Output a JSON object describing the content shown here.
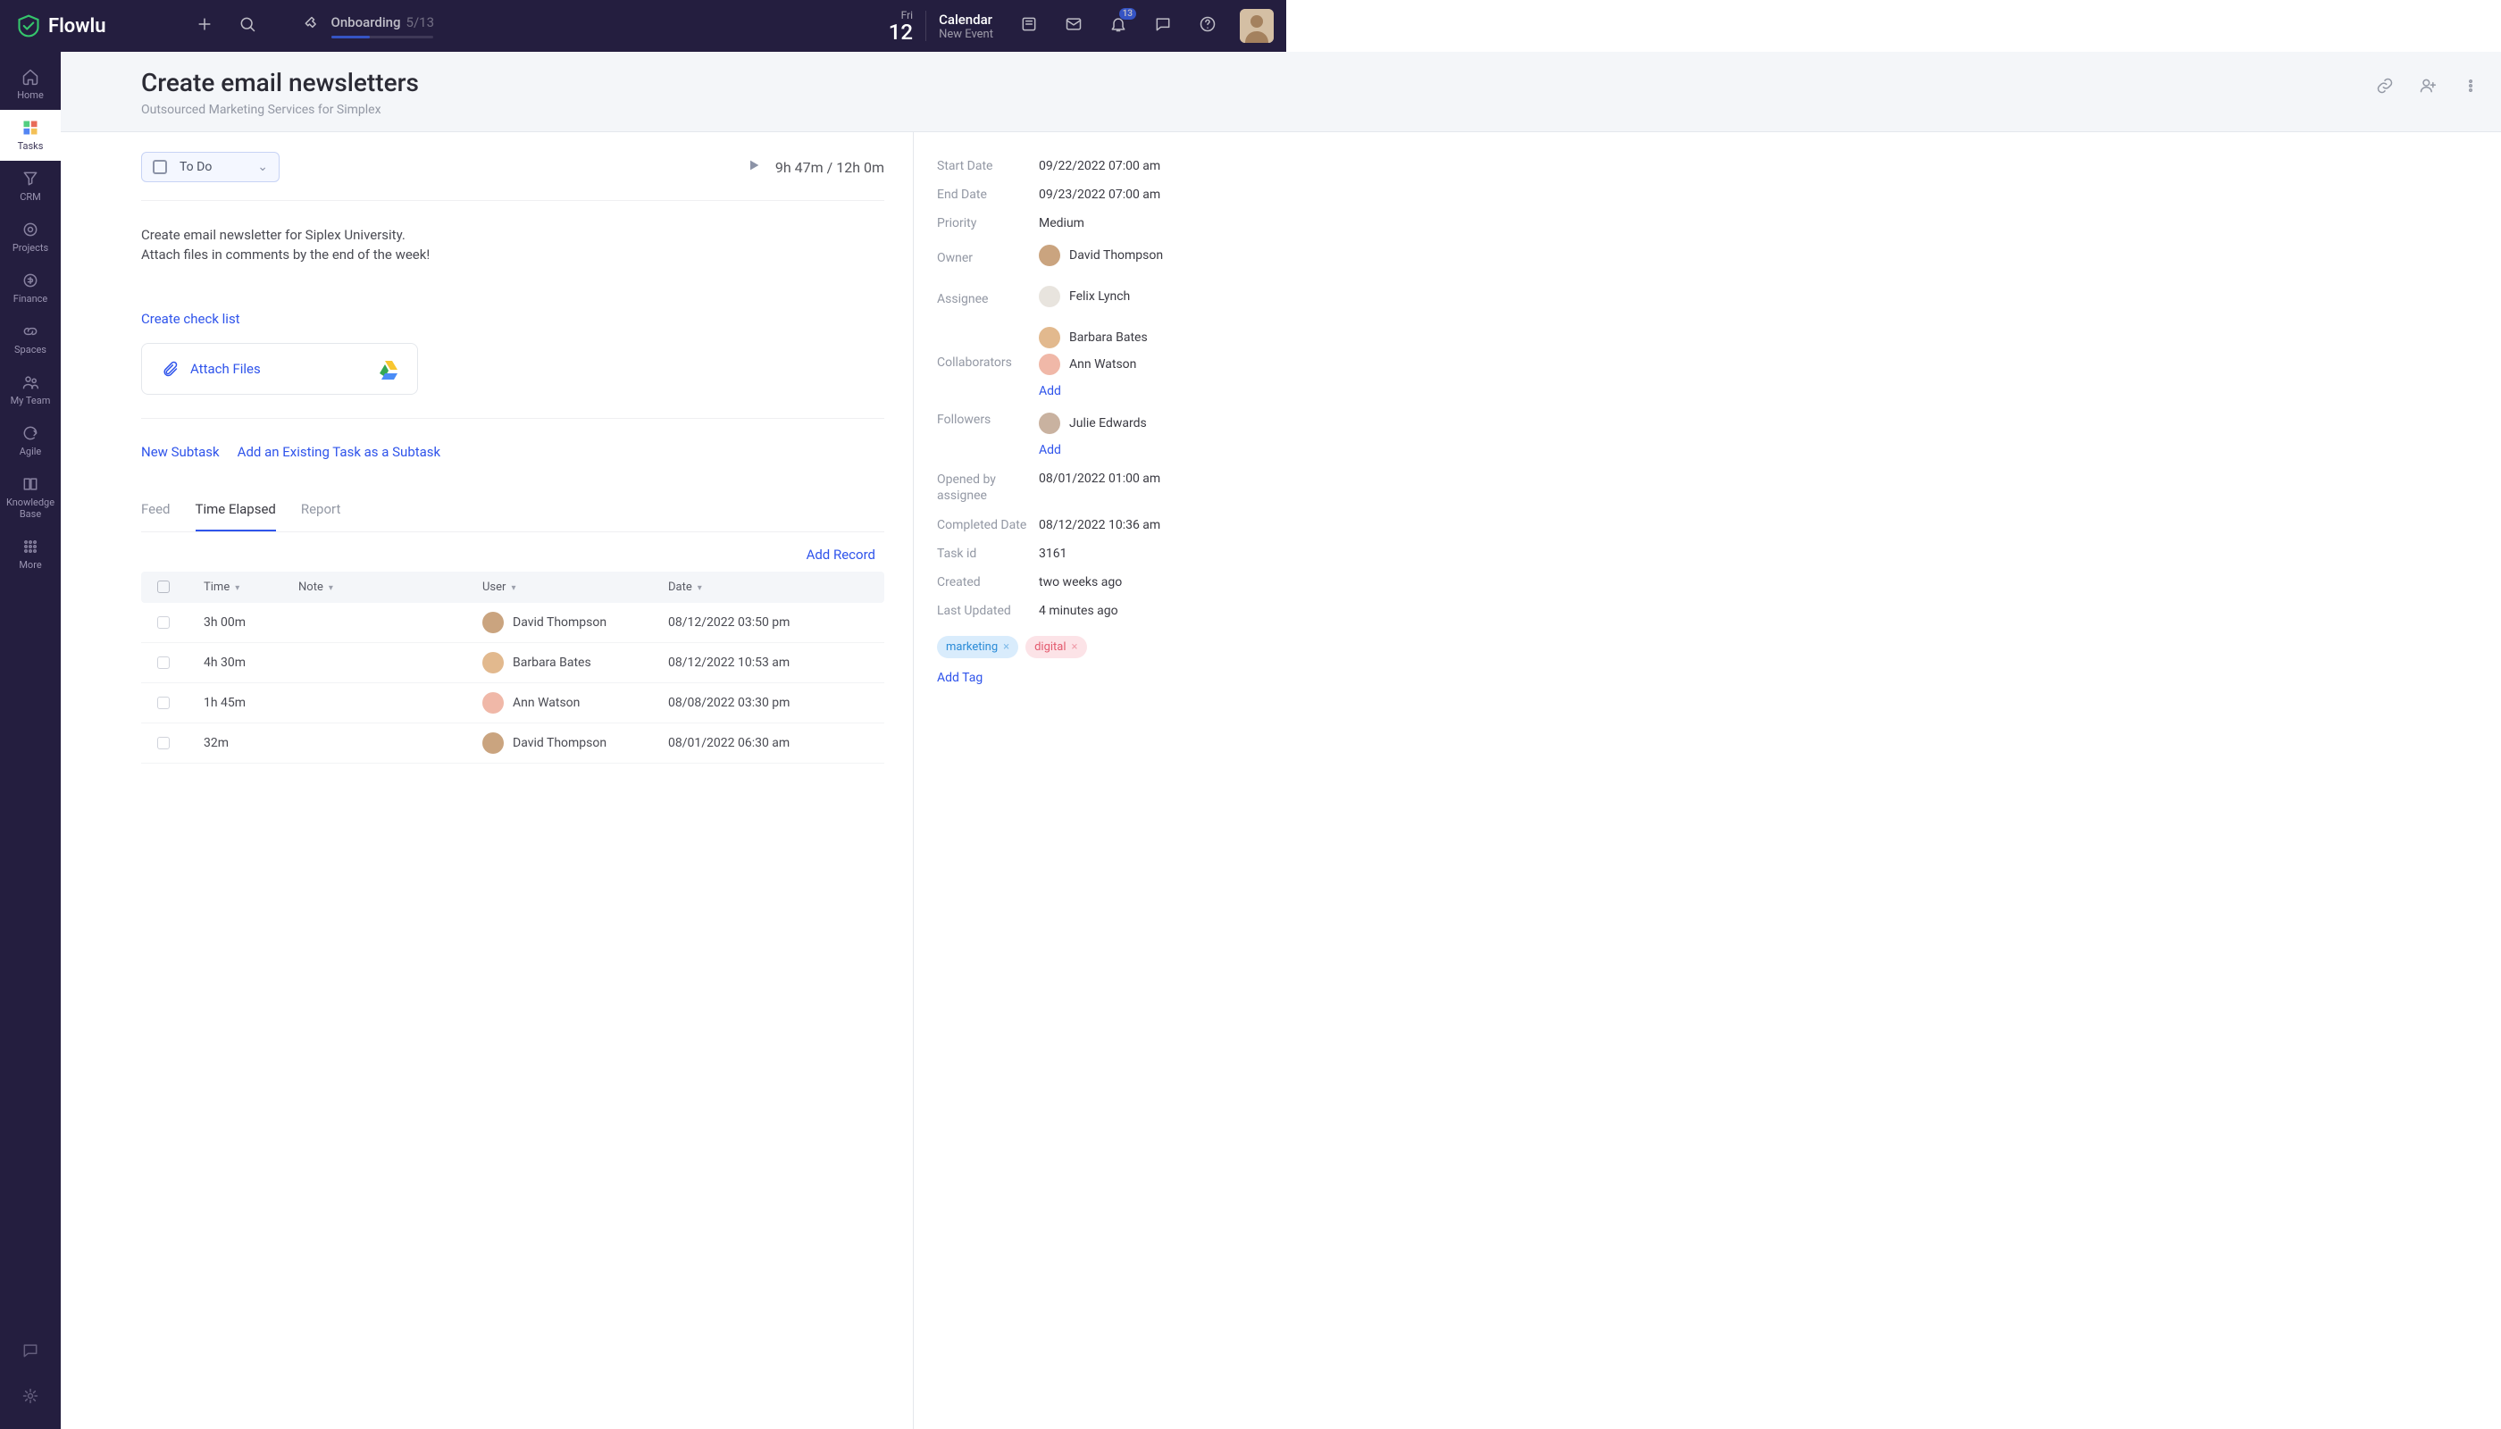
{
  "topbar": {
    "brand": "Flowlu",
    "onboarding": {
      "label": "Onboarding",
      "count": "5/13"
    },
    "date": {
      "dow": "Fri",
      "day": "12"
    },
    "calendar": {
      "title": "Calendar",
      "sub": "New Event"
    },
    "bell_count": "13"
  },
  "rail": {
    "items": [
      {
        "label": "Home"
      },
      {
        "label": "Tasks"
      },
      {
        "label": "CRM"
      },
      {
        "label": "Projects"
      },
      {
        "label": "Finance"
      },
      {
        "label": "Spaces"
      },
      {
        "label": "My Team"
      },
      {
        "label": "Agile"
      },
      {
        "label": "Knowledge Base"
      },
      {
        "label": "More"
      }
    ]
  },
  "header": {
    "title": "Create email newsletters",
    "subtitle": "Outsourced Marketing Services for Simplex"
  },
  "status": {
    "label": "To Do",
    "timer": "9h 47m / 12h 0m"
  },
  "description": {
    "line1": "Create email newsletter for Siplex University.",
    "line2": "Attach files in comments by the end of the week!"
  },
  "links": {
    "checklist": "Create check list",
    "attach": "Attach Files",
    "new_subtask": "New Subtask",
    "add_existing": "Add an Existing Task as a Subtask",
    "add_record": "Add Record",
    "add": "Add",
    "add_tag": "Add Tag"
  },
  "tabs": {
    "feed": "Feed",
    "time": "Time Elapsed",
    "report": "Report"
  },
  "table": {
    "cols": {
      "time": "Time",
      "note": "Note",
      "user": "User",
      "date": "Date"
    },
    "rows": [
      {
        "time": "3h 00m",
        "user": "David Thompson",
        "date": "08/12/2022 03:50 pm",
        "avatar": "#caa47f"
      },
      {
        "time": "4h 30m",
        "user": "Barbara Bates",
        "date": "08/12/2022 10:53 am",
        "avatar": "#e2b98e"
      },
      {
        "time": "1h 45m",
        "user": "Ann Watson",
        "date": "08/08/2022 03:30 pm",
        "avatar": "#f0b8a8"
      },
      {
        "time": "32m",
        "user": "David Thompson",
        "date": "08/01/2022 06:30 am",
        "avatar": "#caa47f"
      }
    ]
  },
  "meta": {
    "start": {
      "label": "Start Date",
      "value": "09/22/2022 07:00 am"
    },
    "end": {
      "label": "End Date",
      "value": "09/23/2022 07:00 am"
    },
    "priority": {
      "label": "Priority",
      "value": "Medium"
    },
    "owner": {
      "label": "Owner",
      "value": "David Thompson",
      "avatar": "#caa47f"
    },
    "assignee": {
      "label": "Assignee",
      "value": "Felix Lynch",
      "avatar": "#e8e4de"
    },
    "collaborators": {
      "label": "Collaborators",
      "people": [
        {
          "name": "Barbara Bates",
          "avatar": "#e2b98e"
        },
        {
          "name": "Ann Watson",
          "avatar": "#f0b8a8"
        }
      ]
    },
    "followers": {
      "label": "Followers",
      "people": [
        {
          "name": "Julie Edwards",
          "avatar": "#c9b2a0"
        }
      ]
    },
    "opened": {
      "label": "Opened by assignee",
      "value": "08/01/2022 01:00 am"
    },
    "completed": {
      "label": "Completed Date",
      "value": "08/12/2022 10:36 am"
    },
    "taskid": {
      "label": "Task id",
      "value": "3161"
    },
    "created": {
      "label": "Created",
      "value": "two weeks ago"
    },
    "updated": {
      "label": "Last Updated",
      "value": "4 minutes ago"
    }
  },
  "tags": [
    {
      "text": "marketing",
      "class": "blue"
    },
    {
      "text": "digital",
      "class": "pink"
    }
  ]
}
